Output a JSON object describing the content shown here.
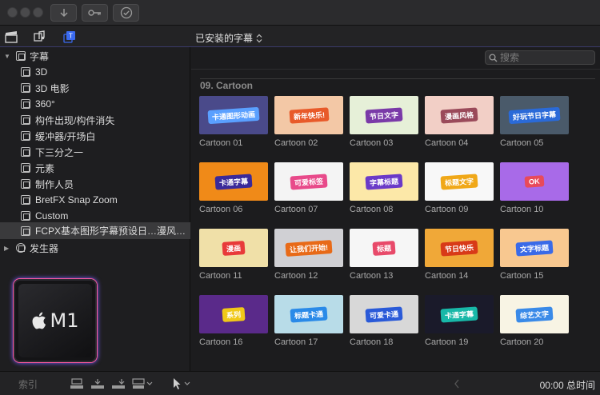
{
  "subbar": {
    "category_title": "已安装的字幕"
  },
  "sidebar": {
    "root": {
      "label": "字幕",
      "expanded": true
    },
    "items": [
      {
        "label": "3D"
      },
      {
        "label": "3D 电影"
      },
      {
        "label": "360°"
      },
      {
        "label": "构件出现/构件消失"
      },
      {
        "label": "缓冲器/开场白"
      },
      {
        "label": "下三分之一"
      },
      {
        "label": "元素"
      },
      {
        "label": "制作人员"
      },
      {
        "label": "BretFX Snap Zoom"
      },
      {
        "label": "Custom"
      },
      {
        "label": "FCPX基本图形字幕预设日…漫风格卡通",
        "selected": true
      }
    ],
    "generators": {
      "label": "发生器",
      "expanded": false
    },
    "chip_label": "M1"
  },
  "browser": {
    "search_placeholder": "搜索",
    "section_title": "09. Cartoon",
    "items": [
      {
        "label": "Cartoon 01",
        "bg": "#4a4a8a",
        "badge_bg": "#5aa0ff",
        "badge": "卡通图形动画"
      },
      {
        "label": "Cartoon 02",
        "bg": "#f3c8a6",
        "badge_bg": "#e85a2a",
        "badge": "新年快乐!"
      },
      {
        "label": "Cartoon 03",
        "bg": "#e6f0d8",
        "badge_bg": "#7a3aa8",
        "badge": "节日文字"
      },
      {
        "label": "Cartoon 04",
        "bg": "#f2cfc6",
        "badge_bg": "#9a4a5a",
        "badge": "漫画风格"
      },
      {
        "label": "Cartoon 05",
        "bg": "#4a5a6a",
        "badge_bg": "#2a6ad8",
        "badge": "好玩节日字幕"
      },
      {
        "label": "Cartoon 06",
        "bg": "#f08a18",
        "badge_bg": "#3a2a9a",
        "badge": "卡通字幕"
      },
      {
        "label": "Cartoon 07",
        "bg": "#f4f4f4",
        "badge_bg": "#e84a8a",
        "badge": "可爱标签"
      },
      {
        "label": "Cartoon 08",
        "bg": "#fce8a8",
        "badge_bg": "#6a3ac8",
        "badge": "字幕标题"
      },
      {
        "label": "Cartoon 09",
        "bg": "#f8f8f8",
        "badge_bg": "#f0a818",
        "badge": "标题文字"
      },
      {
        "label": "Cartoon 10",
        "bg": "#a86ae8",
        "badge_bg": "#e84a5a",
        "badge": "OK"
      },
      {
        "label": "Cartoon 11",
        "bg": "#f0e0a8",
        "badge_bg": "#e83a3a",
        "badge": "漫画"
      },
      {
        "label": "Cartoon 12",
        "bg": "#d0d0d4",
        "badge_bg": "#e86a18",
        "badge": "让我们开始!"
      },
      {
        "label": "Cartoon 13",
        "bg": "#f6f6f6",
        "badge_bg": "#e84a6a",
        "badge": "标题"
      },
      {
        "label": "Cartoon 14",
        "bg": "#f0a838",
        "badge_bg": "#d83a18",
        "badge": "节日快乐"
      },
      {
        "label": "Cartoon 15",
        "bg": "#f8c890",
        "badge_bg": "#3a6ae8",
        "badge": "文字标题"
      },
      {
        "label": "Cartoon 16",
        "bg": "#5a2a8a",
        "badge_bg": "#f0c818",
        "badge": "系列"
      },
      {
        "label": "Cartoon 17",
        "bg": "#b8dce8",
        "badge_bg": "#2a8ae8",
        "badge": "标题卡通"
      },
      {
        "label": "Cartoon 18",
        "bg": "#d8d8d8",
        "badge_bg": "#2a5ad8",
        "badge": "可爱卡通"
      },
      {
        "label": "Cartoon 19",
        "bg": "#1a1a2a",
        "badge_bg": "#18b8a8",
        "badge": "卡通字幕"
      },
      {
        "label": "Cartoon 20",
        "bg": "#f8f4e4",
        "badge_bg": "#3a8ae8",
        "badge": "综艺文字"
      }
    ]
  },
  "bottombar": {
    "index_label": "索引",
    "timecode": "00:00 总时间"
  }
}
